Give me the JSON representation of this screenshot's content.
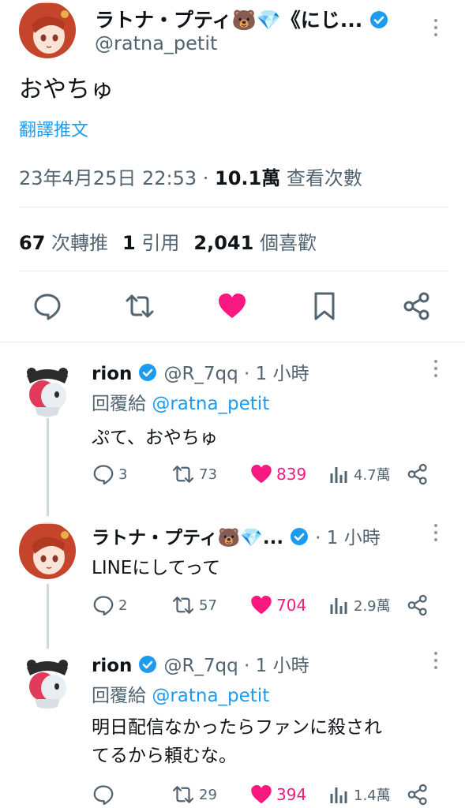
{
  "main": {
    "author_name": "ラトナ・プティ🐻💎《にじ...",
    "handle": "@ratna_petit",
    "text": "おやちゅ",
    "translate": "翻譯推文",
    "datetime": "23年4月25日 22:53 · ",
    "views_count": "10.1萬",
    "views_label": " 查看次數",
    "retweets_count": "67",
    "retweets_label": " 次轉推",
    "quotes_count": "1",
    "quotes_label": " 引用",
    "likes_count": "2,041",
    "likes_label": " 個喜歡"
  },
  "replies": [
    {
      "name": "rion",
      "handle": "@R_7qq · 1 小時",
      "reply_to_label": "回覆給 ",
      "reply_to": "@ratna_petit",
      "text": "ぷて、おやちゅ",
      "replies": "3",
      "retweets": "73",
      "likes": "839",
      "views": "4.7萬"
    },
    {
      "name": "ラトナ・プティ🐻💎...",
      "handle": " · 1 小時",
      "text": "LINEにしてって",
      "replies": "2",
      "retweets": "57",
      "likes": "704",
      "views": "2.9萬"
    },
    {
      "name": "rion",
      "handle": "@R_7qq · 1 小時",
      "reply_to_label": "回覆給 ",
      "reply_to": "@ratna_petit",
      "text_line1": "明日配信なかったらファンに殺され",
      "text_line2": "てるから頼むな。",
      "replies": "",
      "retweets": "29",
      "likes": "394",
      "views": "1.4萬"
    }
  ],
  "colors": {
    "accent": "#1d9bf0",
    "like": "#f91880",
    "muted": "#536471"
  },
  "icons": [
    "reply-icon",
    "retweet-icon",
    "heart-icon",
    "bookmark-icon",
    "share-icon",
    "views-icon",
    "verified-badge-icon",
    "more-icon"
  ]
}
